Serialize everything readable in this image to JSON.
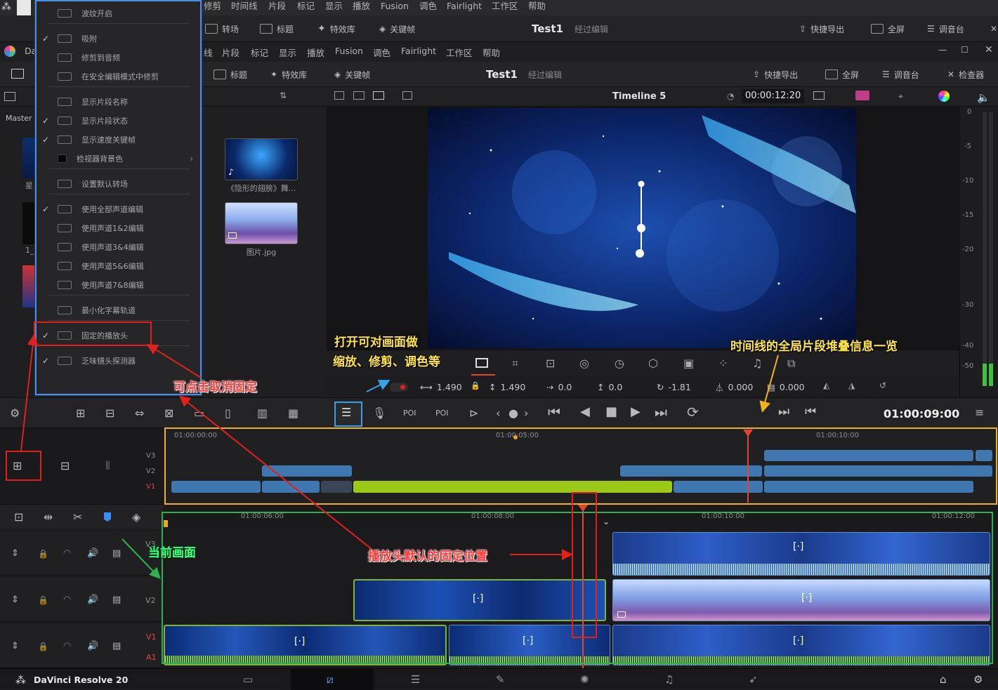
{
  "menu1": {
    "items": [
      "修剪",
      "时间线",
      "片段",
      "标记",
      "显示",
      "播放",
      "Fusion",
      "调色",
      "Fairlight",
      "工作区",
      "帮助"
    ]
  },
  "toolbar1": {
    "transitions": "转场",
    "titles": "标题",
    "effects": "特效库",
    "keyframes": "关键帧",
    "project": "Test1",
    "status": "经过编辑",
    "quick_export": "快捷导出",
    "fullscreen": "全屏",
    "mixer": "调音台"
  },
  "winbar": {
    "app_short": "Da",
    "menu_items": [
      "线",
      "片段",
      "标记",
      "显示",
      "播放",
      "Fusion",
      "调色",
      "Fairlight",
      "工作区",
      "帮助"
    ]
  },
  "toolbar2": {
    "titles": "标题",
    "effects": "特效库",
    "keyframes": "关键帧",
    "project": "Test1",
    "status": "经过编辑",
    "quick_export": "快捷导出",
    "fullscreen": "全屏",
    "mixer": "调音台",
    "inspector": "检查器"
  },
  "tabline": {
    "timeline_name": "Timeline 5",
    "timecode": "00:00:12:20"
  },
  "mediapool": {
    "bin_label": "Master /",
    "clips": [
      {
        "name": "《隐形的翅膀》舞...",
        "type": "video"
      },
      {
        "name": "图片.jpg",
        "type": "image"
      }
    ],
    "left_labels": [
      "星",
      "1_"
    ]
  },
  "context_menu": {
    "items": [
      {
        "label": "波纹开启",
        "checked": false
      },
      {
        "label": "吸附",
        "checked": true
      },
      {
        "label": "修剪到音频",
        "checked": false
      },
      {
        "label": "在安全编辑模式中修剪",
        "checked": false
      },
      {
        "label": "显示片段名称",
        "checked": false
      },
      {
        "label": "显示片段状态",
        "checked": true
      },
      {
        "label": "显示速度关键帧",
        "checked": true
      },
      {
        "label": "检视器背景色",
        "checked": false,
        "submenu": true
      },
      {
        "label": "设置默认转场",
        "checked": false
      },
      {
        "label": "使用全部声道编辑",
        "checked": true
      },
      {
        "label": "使用声道1&2编辑",
        "checked": false
      },
      {
        "label": "使用声道3&4编辑",
        "checked": false
      },
      {
        "label": "使用声道5&6编辑",
        "checked": false
      },
      {
        "label": "使用声道7&8编辑",
        "checked": false
      },
      {
        "label": "最小化字幕轨道",
        "checked": false
      },
      {
        "label": "固定的播放头",
        "checked": true
      },
      {
        "label": "乏味镜头探测器",
        "checked": true
      }
    ]
  },
  "params": {
    "zoom_x": "1.490",
    "zoom_y": "1.490",
    "pos_x": "0.0",
    "pos_y": "0.0",
    "rotation": "-1.81",
    "anchor": "0.000",
    "pitch": "0.000"
  },
  "transport": {
    "timecode": "01:00:09:00"
  },
  "minitimeline": {
    "ruler": [
      "01:00:00:00",
      "01:00:05:00",
      "01:00:10:00"
    ],
    "tracks": [
      "V3",
      "V2",
      "V1"
    ]
  },
  "timeline": {
    "ruler": [
      "01:00:06:00",
      "01:00:08:00",
      "01:00:10:00",
      "01:00:12:00"
    ],
    "tracks": [
      "V3",
      "V2",
      "V1",
      "A1"
    ]
  },
  "status": {
    "app": "DaVinci Resolve 20"
  },
  "annotations": {
    "open_viewer": "打开可对画面做",
    "open_viewer2": "缩放、修剪、调色等",
    "overview": "时间线的全局片段堆叠信息一览",
    "uncheck": "可点击取消固定",
    "current": "当前画面",
    "playhead_pos": "播放头默认的固定位置"
  },
  "colors": {
    "accent": "#e3462e",
    "clip_blue": "#3f78b0",
    "clip_green": "#9cc918",
    "yellow_box": "#f2b11f",
    "green_box": "#2fb14f",
    "red_box": "#e0201b",
    "blue_box": "#3aa0e8"
  }
}
